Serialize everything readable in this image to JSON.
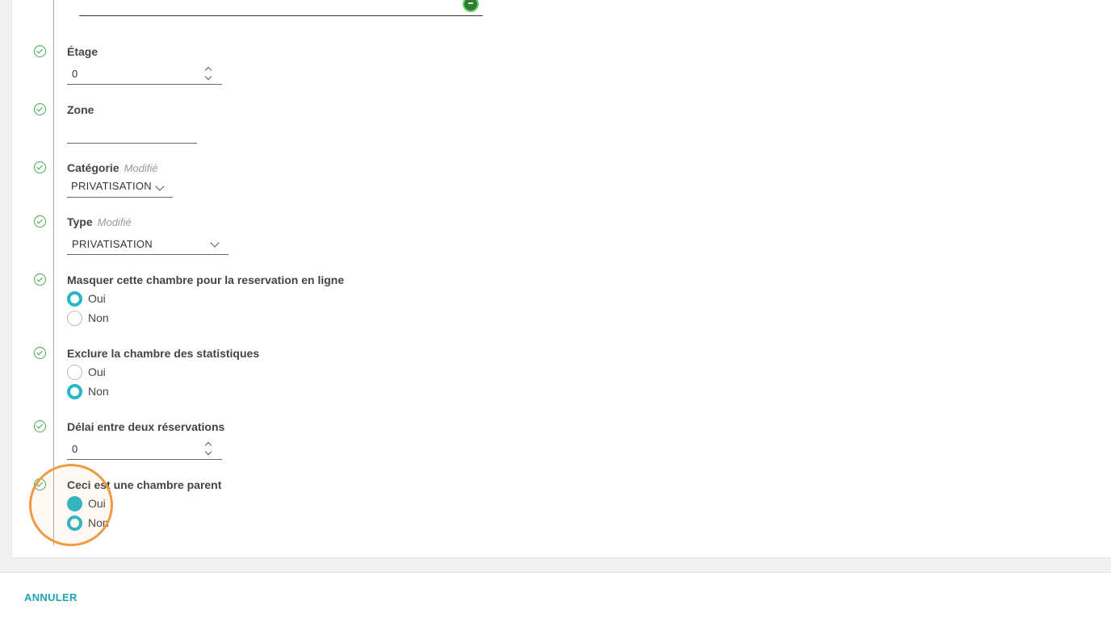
{
  "form": {
    "floor": {
      "label": "Étage",
      "value": "0"
    },
    "zone": {
      "label": "Zone",
      "value": ""
    },
    "category": {
      "label": "Catégorie",
      "modified": "Modifié",
      "value": "PRIVATISATION"
    },
    "type": {
      "label": "Type",
      "modified": "Modifié",
      "value": "PRIVATISATION"
    },
    "hide_online": {
      "label": "Masquer cette chambre pour la reservation en ligne",
      "options": [
        "Oui",
        "Non"
      ],
      "selected": "Oui"
    },
    "exclude_stats": {
      "label": "Exclure la chambre des statistiques",
      "options": [
        "Oui",
        "Non"
      ],
      "selected": "Non"
    },
    "delay": {
      "label": "Délai entre deux réservations",
      "value": "0"
    },
    "parent_room": {
      "label": "Ceci est une chambre parent",
      "options": [
        "Oui",
        "Non"
      ],
      "selected": "Non"
    }
  },
  "footer": {
    "cancel_label": "ANNULER"
  },
  "colors": {
    "accent": "#29b6c6",
    "step_check": "#47a84f",
    "highlight": "#f09a44",
    "link": "#1fa3b5"
  }
}
